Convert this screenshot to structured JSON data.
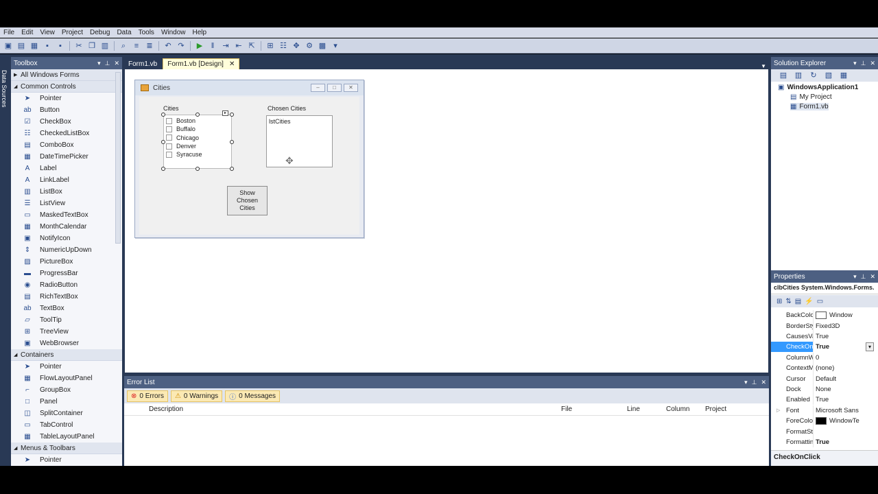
{
  "menu": [
    "File",
    "Edit",
    "View",
    "Project",
    "Debug",
    "Data",
    "Tools",
    "Window",
    "Help"
  ],
  "sidestrip": {
    "label": "Data Sources"
  },
  "toolbox": {
    "title": "Toolbox",
    "rows": [
      {
        "kind": "cat",
        "label": "All Windows Forms",
        "arrow": "▶"
      },
      {
        "kind": "cat",
        "label": "Common Controls",
        "arrow": "◢"
      },
      {
        "kind": "item",
        "label": "Pointer",
        "icon": "pointer-icon",
        "glyph": "➤"
      },
      {
        "kind": "item",
        "label": "Button",
        "icon": "button-icon",
        "glyph": "ab"
      },
      {
        "kind": "item",
        "label": "CheckBox",
        "icon": "checkbox-icon",
        "glyph": "☑"
      },
      {
        "kind": "item",
        "label": "CheckedListBox",
        "icon": "checkedlistbox-icon",
        "glyph": "☷"
      },
      {
        "kind": "item",
        "label": "ComboBox",
        "icon": "combobox-icon",
        "glyph": "▤"
      },
      {
        "kind": "item",
        "label": "DateTimePicker",
        "icon": "datetimepicker-icon",
        "glyph": "▦"
      },
      {
        "kind": "item",
        "label": "Label",
        "icon": "label-icon",
        "glyph": "A"
      },
      {
        "kind": "item",
        "label": "LinkLabel",
        "icon": "linklabel-icon",
        "glyph": "A"
      },
      {
        "kind": "item",
        "label": "ListBox",
        "icon": "listbox-icon",
        "glyph": "▥"
      },
      {
        "kind": "item",
        "label": "ListView",
        "icon": "listview-icon",
        "glyph": "☰"
      },
      {
        "kind": "item",
        "label": "MaskedTextBox",
        "icon": "maskedtextbox-icon",
        "glyph": "▭"
      },
      {
        "kind": "item",
        "label": "MonthCalendar",
        "icon": "monthcalendar-icon",
        "glyph": "▦"
      },
      {
        "kind": "item",
        "label": "NotifyIcon",
        "icon": "notifyicon-icon",
        "glyph": "▣"
      },
      {
        "kind": "item",
        "label": "NumericUpDown",
        "icon": "numericupdown-icon",
        "glyph": "⇕"
      },
      {
        "kind": "item",
        "label": "PictureBox",
        "icon": "picturebox-icon",
        "glyph": "▨"
      },
      {
        "kind": "item",
        "label": "ProgressBar",
        "icon": "progressbar-icon",
        "glyph": "▬"
      },
      {
        "kind": "item",
        "label": "RadioButton",
        "icon": "radiobutton-icon",
        "glyph": "◉"
      },
      {
        "kind": "item",
        "label": "RichTextBox",
        "icon": "richtextbox-icon",
        "glyph": "▤"
      },
      {
        "kind": "item",
        "label": "TextBox",
        "icon": "textbox-icon",
        "glyph": "ab"
      },
      {
        "kind": "item",
        "label": "ToolTip",
        "icon": "tooltip-icon",
        "glyph": "▱"
      },
      {
        "kind": "item",
        "label": "TreeView",
        "icon": "treeview-icon",
        "glyph": "⊞"
      },
      {
        "kind": "item",
        "label": "WebBrowser",
        "icon": "webbrowser-icon",
        "glyph": "▣"
      },
      {
        "kind": "cat",
        "label": "Containers",
        "arrow": "◢"
      },
      {
        "kind": "item",
        "label": "Pointer",
        "icon": "pointer-icon",
        "glyph": "➤"
      },
      {
        "kind": "item",
        "label": "FlowLayoutPanel",
        "icon": "flowlayoutpanel-icon",
        "glyph": "▦"
      },
      {
        "kind": "item",
        "label": "GroupBox",
        "icon": "groupbox-icon",
        "glyph": "⌐"
      },
      {
        "kind": "item",
        "label": "Panel",
        "icon": "panel-icon",
        "glyph": "□"
      },
      {
        "kind": "item",
        "label": "SplitContainer",
        "icon": "splitcontainer-icon",
        "glyph": "◫"
      },
      {
        "kind": "item",
        "label": "TabControl",
        "icon": "tabcontrol-icon",
        "glyph": "▭"
      },
      {
        "kind": "item",
        "label": "TableLayoutPanel",
        "icon": "tablelayoutpanel-icon",
        "glyph": "▦"
      },
      {
        "kind": "cat",
        "label": "Menus & Toolbars",
        "arrow": "◢"
      },
      {
        "kind": "item",
        "label": "Pointer",
        "icon": "pointer-icon",
        "glyph": "➤"
      }
    ]
  },
  "tabs": [
    {
      "label": "Form1.vb",
      "active": false
    },
    {
      "label": "Form1.vb [Design]",
      "active": true,
      "close": "✕"
    }
  ],
  "form": {
    "title": "Cities",
    "cities_label": "Cities",
    "chosen_label": "Chosen Cities",
    "items": [
      "Boston",
      "Buffalo",
      "Chicago",
      "Denver",
      "Syracuse"
    ],
    "listbox_text": "lstCities",
    "button_text": "Show Chosen Cities"
  },
  "error_list": {
    "title": "Error List",
    "errors": "0 Errors",
    "warnings": "0 Warnings",
    "messages": "0 Messages",
    "columns": [
      "Description",
      "File",
      "Line",
      "Column",
      "Project"
    ]
  },
  "solution_explorer": {
    "title": "Solution Explorer",
    "solution": "WindowsApplication1",
    "children": [
      "My Project",
      "Form1.vb"
    ]
  },
  "properties": {
    "title": "Properties",
    "object": "clbCities System.Windows.Forms.",
    "rows": [
      {
        "name": "BackColor",
        "value": "Window",
        "swatch": "#ffffff"
      },
      {
        "name": "BorderStyle",
        "value": "Fixed3D"
      },
      {
        "name": "CausesValida",
        "value": "True"
      },
      {
        "name": "CheckOnClic",
        "value": "True",
        "selected": true,
        "bold": true,
        "dropdown": "▾"
      },
      {
        "name": "ColumnWidt",
        "value": "0"
      },
      {
        "name": "ContextMen",
        "value": "(none)"
      },
      {
        "name": "Cursor",
        "value": "Default"
      },
      {
        "name": "Dock",
        "value": "None"
      },
      {
        "name": "Enabled",
        "value": "True"
      },
      {
        "name": "Font",
        "value": "Microsoft Sans",
        "expand": "▷"
      },
      {
        "name": "ForeColor",
        "value": "WindowTe",
        "swatch": "#000000"
      },
      {
        "name": "FormatString",
        "value": ""
      },
      {
        "name": "FormattingEr",
        "value": "True",
        "bold": true
      }
    ],
    "description_title": "CheckOnClick"
  }
}
